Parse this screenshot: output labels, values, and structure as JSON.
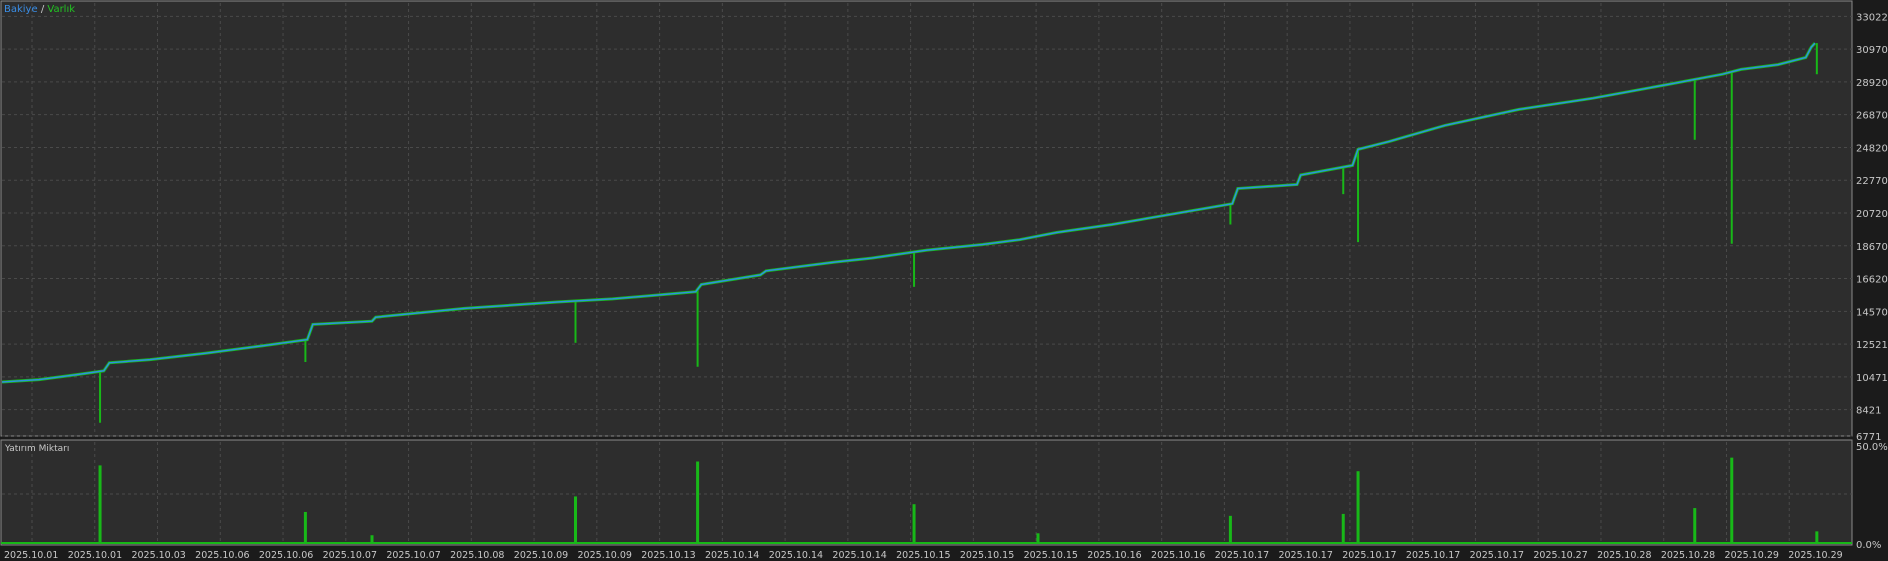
{
  "chart_data": [
    {
      "type": "line",
      "legend": {
        "bakiye": "Bakiye",
        "separator": " / ",
        "varlik": "Varlık",
        "placement": "top-left"
      },
      "colors": {
        "bakiye": "#2f8fe0",
        "varlik": "#18b818",
        "background": "#2d2d2d",
        "grid": "#4a4a4a"
      },
      "grid": true,
      "y_axis_side": "right",
      "ylim": [
        6771,
        33856
      ],
      "yticks": [
        33022,
        30970,
        28920,
        26870,
        24820,
        22770,
        20720,
        18670,
        16620,
        14570,
        12521,
        10471,
        8421,
        6771
      ],
      "series": [
        {
          "name": "Bakiye",
          "x": [
            0,
            0.02,
            0.04,
            0.055,
            0.058,
            0.08,
            0.11,
            0.14,
            0.165,
            0.168,
            0.2,
            0.202,
            0.25,
            0.3,
            0.33,
            0.36,
            0.375,
            0.378,
            0.41,
            0.413,
            0.45,
            0.47,
            0.5,
            0.53,
            0.55,
            0.57,
            0.6,
            0.64,
            0.665,
            0.668,
            0.7,
            0.702,
            0.73,
            0.733,
            0.75,
            0.78,
            0.82,
            0.86,
            0.9,
            0.93,
            0.94,
            0.96,
            0.975,
            0.978,
            0.98
          ],
          "values": [
            10150,
            10300,
            10600,
            10850,
            11350,
            11550,
            11950,
            12400,
            12800,
            13750,
            13950,
            14200,
            14750,
            15150,
            15350,
            15650,
            15800,
            16250,
            16850,
            17100,
            17650,
            17900,
            18400,
            18750,
            19050,
            19500,
            20000,
            20800,
            21300,
            22250,
            22500,
            23100,
            23700,
            24700,
            25200,
            26200,
            27200,
            27900,
            28750,
            29400,
            29700,
            30000,
            30450,
            31100,
            31350
          ]
        },
        {
          "name": "Varlık",
          "spikes": [
            {
              "x": 0.053,
              "low": 7600
            },
            {
              "x": 0.164,
              "low": 11400
            },
            {
              "x": 0.31,
              "low": 12600
            },
            {
              "x": 0.376,
              "low": 11100
            },
            {
              "x": 0.493,
              "low": 16100
            },
            {
              "x": 0.664,
              "low": 20000
            },
            {
              "x": 0.725,
              "low": 21900
            },
            {
              "x": 0.733,
              "low": 18900
            },
            {
              "x": 0.915,
              "low": 25300
            },
            {
              "x": 0.935,
              "low": 18800
            },
            {
              "x": 0.981,
              "low": 29400
            }
          ]
        }
      ]
    },
    {
      "type": "bar",
      "title": "Yatırım Miktarı",
      "colors": {
        "bars": "#18b818",
        "background": "#2d2d2d"
      },
      "ylim": [
        0,
        50
      ],
      "yticks": [
        "50.0%",
        "0.0%"
      ],
      "values": [
        {
          "x": 0.053,
          "v": 40
        },
        {
          "x": 0.164,
          "v": 16
        },
        {
          "x": 0.2,
          "v": 4
        },
        {
          "x": 0.31,
          "v": 24
        },
        {
          "x": 0.376,
          "v": 42
        },
        {
          "x": 0.493,
          "v": 20
        },
        {
          "x": 0.56,
          "v": 5
        },
        {
          "x": 0.664,
          "v": 14
        },
        {
          "x": 0.725,
          "v": 15
        },
        {
          "x": 0.733,
          "v": 37
        },
        {
          "x": 0.915,
          "v": 18
        },
        {
          "x": 0.935,
          "v": 44
        },
        {
          "x": 0.981,
          "v": 6
        }
      ],
      "xticks": [
        "2025.10.01",
        "2025.10.01",
        "2025.10.03",
        "2025.10.06",
        "2025.10.06",
        "2025.10.07",
        "2025.10.07",
        "2025.10.08",
        "2025.10.09",
        "2025.10.09",
        "2025.10.13",
        "2025.10.14",
        "2025.10.14",
        "2025.10.14",
        "2025.10.15",
        "2025.10.15",
        "2025.10.15",
        "2025.10.16",
        "2025.10.16",
        "2025.10.17",
        "2025.10.17",
        "2025.10.17",
        "2025.10.17",
        "2025.10.17",
        "2025.10.27",
        "2025.10.28",
        "2025.10.28",
        "2025.10.29",
        "2025.10.29"
      ]
    }
  ]
}
